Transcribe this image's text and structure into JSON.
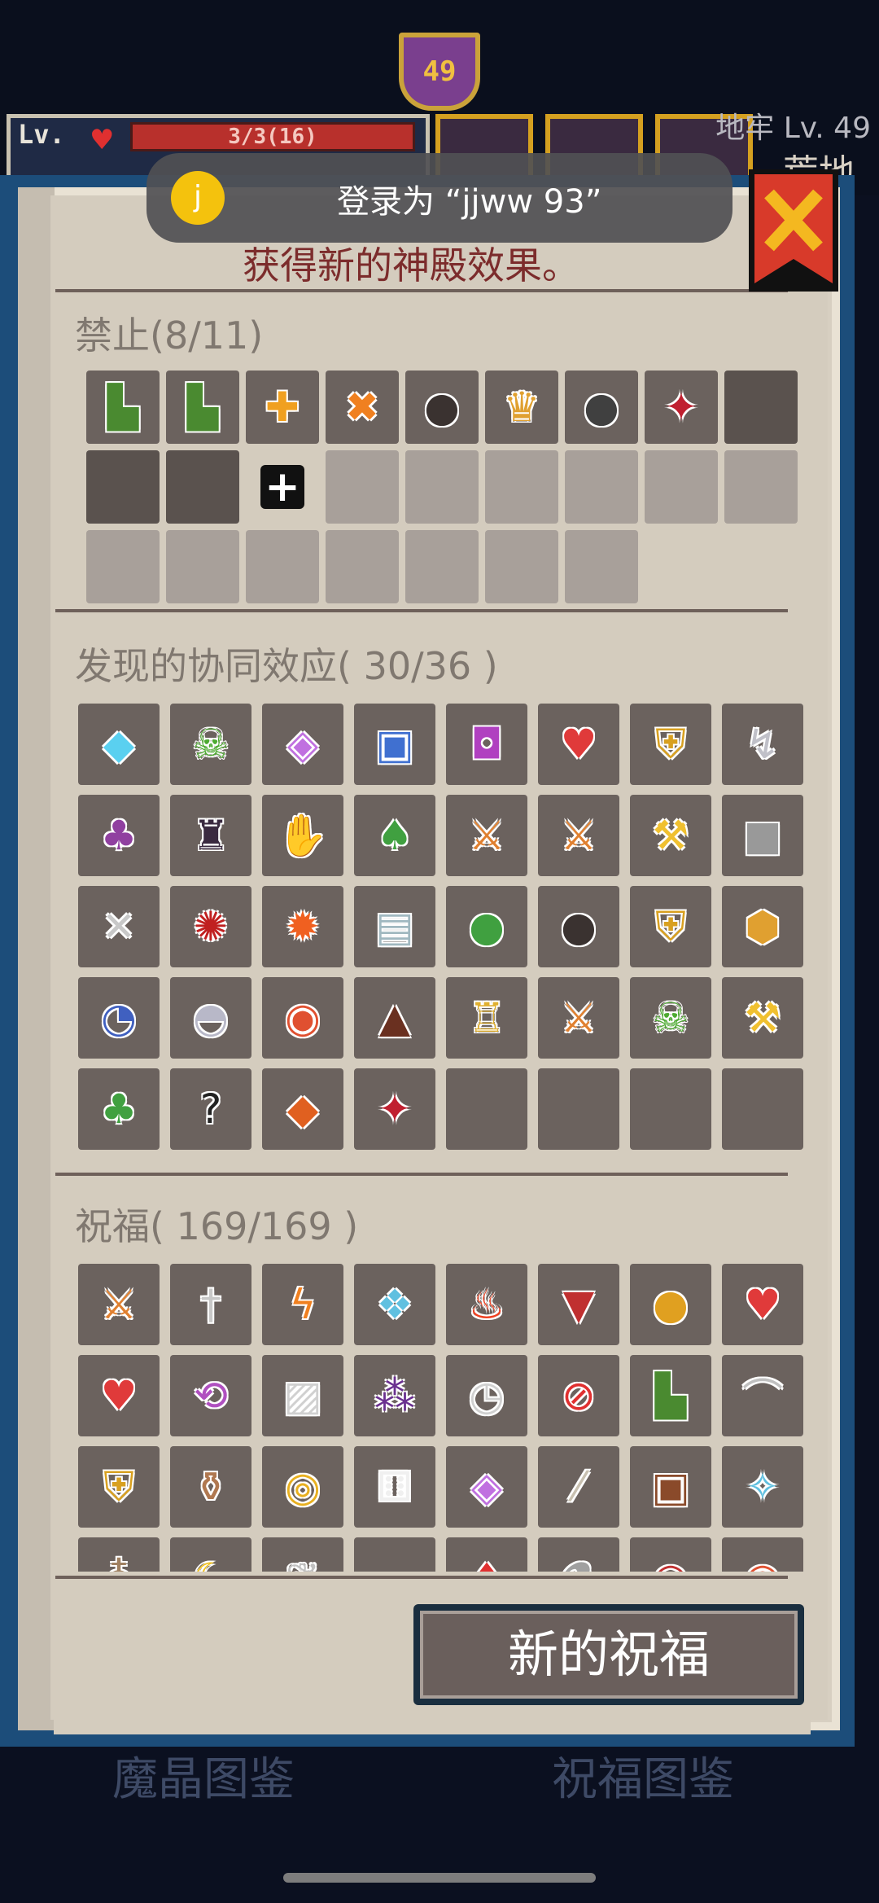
{
  "hud": {
    "skull_badge": "49",
    "level_label": "Lv.",
    "hp_text": "3/3(16)",
    "dungeon_level": "地牢 Lv. 49",
    "dungeon_name": "荒地"
  },
  "toast": {
    "avatar_letter": "j",
    "text": "登录为 “jjww 93”"
  },
  "shrine_text": "获得新的神殿效果。",
  "banned": {
    "title": "禁止(8/11)",
    "items": [
      "green-boot-icon",
      "brown-boot-icon",
      "orange-cross-icon",
      "x-mark-icon",
      "dark-orb-icon",
      "fire-crest-icon",
      "black-bomb-icon",
      "red-star-icon"
    ]
  },
  "synergies": {
    "title": "发现的协同效应( 30/36 )",
    "items": [
      "diamond-icon",
      "green-skull-icon",
      "purple-gem-icon",
      "blue-frame-icon",
      "purple-cube-icon",
      "dark-heart-icon",
      "golden-shield-icon",
      "scythe-icon",
      "purple-mushroom-icon",
      "dark-armor-icon",
      "thumbs-up-icon",
      "palm-island-icon",
      "fire-sword-icon",
      "ice-sword-icon",
      "golden-axe-icon",
      "crossed-swords-icon",
      "crossed-bones-icon",
      "red-vortex-icon",
      "flame-icon",
      "scroll-icon",
      "green-slime-icon",
      "dark-orb-icon",
      "ice-shield-icon",
      "honeycomb-icon",
      "snail-shell-icon",
      "silver-helmet-icon",
      "red-eye-icon",
      "fire-pit-icon",
      "golden-totem-icon",
      "flame-sword-icon",
      "blue-skull-icon",
      "teal-axe-icon",
      "venus-flytrap-icon",
      "mystery-card-icon",
      "lava-rock-icon",
      "sun-star-icon"
    ]
  },
  "blessings": {
    "title": "祝福( 169/169 )",
    "items": [
      "no-sword-icon",
      "dagger-icon",
      "lightning-icon",
      "ice-block-icon",
      "fire-icon",
      "monster-jaw-icon",
      "gold-coin-icon",
      "red-heart-icon",
      "blue-heart-icon",
      "swap-icon",
      "mirror-icon",
      "grape-icon",
      "clock-icon",
      "no-arrow-icon",
      "dark-boot-icon",
      "boomerang-icon",
      "shield-icon",
      "potion-bag-icon",
      "gold-ring-icon",
      "dice-icon",
      "purple-gem-icon",
      "bone-icon",
      "treasure-chest-icon",
      "ice-crystal-icon",
      "pouch-icon",
      "banana-icon",
      "feather-icon",
      "cloud-icon",
      "ruby-icon",
      "flask-icon",
      "red-cap-icon",
      "eye-icon"
    ]
  },
  "new_blessing_button": "新的祝福",
  "tabs": {
    "left": "魔晶图鉴",
    "right": "祝福图鉴"
  }
}
